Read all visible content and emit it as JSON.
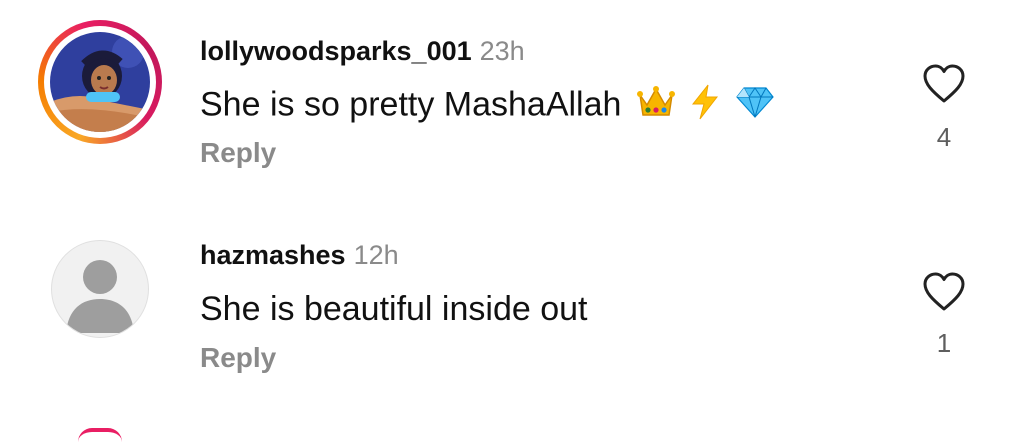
{
  "comments": [
    {
      "username": "lollywoodsparks_001",
      "time": "23h",
      "text": "She is so pretty MashaAllah",
      "reply_label": "Reply",
      "likes": "4",
      "has_story_ring": true
    },
    {
      "username": "hazmashes",
      "time": "12h",
      "text": "She is beautiful inside out",
      "reply_label": "Reply",
      "likes": "1",
      "has_story_ring": false
    }
  ],
  "icons": {
    "like": "heart-outline-icon",
    "emojis": [
      "crown-emoji",
      "lightning-emoji",
      "gem-emoji"
    ]
  },
  "colors": {
    "story_ring": [
      "#f9a825",
      "#e91e63",
      "#c2185b"
    ],
    "muted_text": "#8a8a8a"
  }
}
